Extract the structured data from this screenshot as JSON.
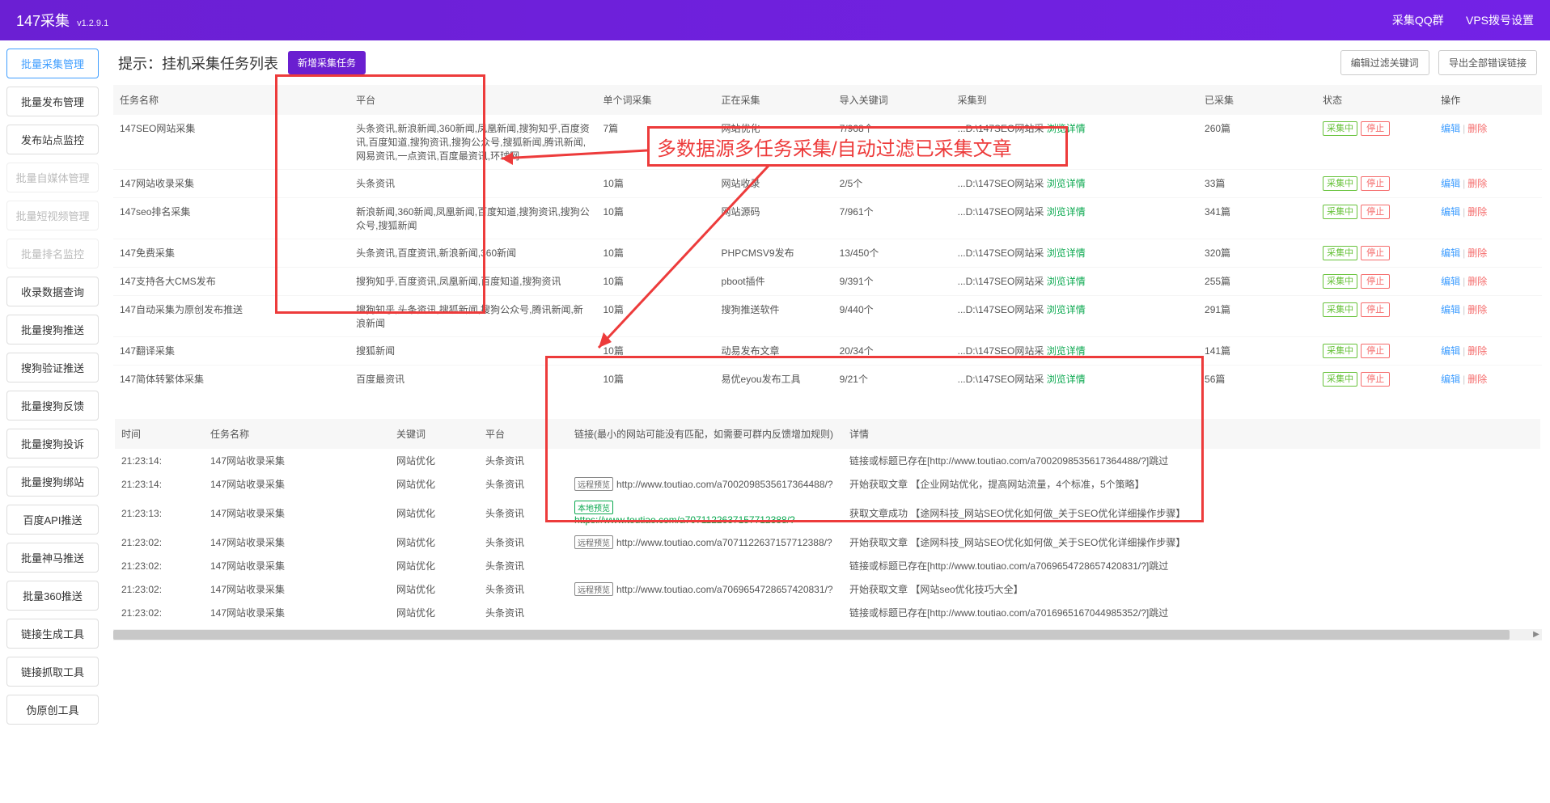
{
  "header": {
    "title": "147采集",
    "version": "v1.2.9.1",
    "right_links": [
      "采集QQ群",
      "VPS拨号设置"
    ]
  },
  "sidebar": {
    "items": [
      {
        "label": "批量采集管理",
        "state": "active"
      },
      {
        "label": "批量发布管理",
        "state": ""
      },
      {
        "label": "发布站点监控",
        "state": ""
      },
      {
        "label": "批量自媒体管理",
        "state": "disabled"
      },
      {
        "label": "批量短视频管理",
        "state": "disabled"
      },
      {
        "label": "批量排名监控",
        "state": "disabled"
      },
      {
        "label": "收录数据查询",
        "state": ""
      },
      {
        "label": "批量搜狗推送",
        "state": ""
      },
      {
        "label": "搜狗验证推送",
        "state": ""
      },
      {
        "label": "批量搜狗反馈",
        "state": ""
      },
      {
        "label": "批量搜狗投诉",
        "state": ""
      },
      {
        "label": "批量搜狗绑站",
        "state": ""
      },
      {
        "label": "百度API推送",
        "state": ""
      },
      {
        "label": "批量神马推送",
        "state": ""
      },
      {
        "label": "批量360推送",
        "state": ""
      },
      {
        "label": "链接生成工具",
        "state": ""
      },
      {
        "label": "链接抓取工具",
        "state": ""
      },
      {
        "label": "伪原创工具",
        "state": ""
      }
    ]
  },
  "page": {
    "heading": "提示：挂机采集任务列表",
    "new_btn": "新增采集任务",
    "btn_filter": "编辑过滤关键词",
    "btn_export": "导出全部错误链接"
  },
  "annotation": {
    "text": "多数据源多任务采集/自动过滤已采集文章"
  },
  "tasks": {
    "headers": {
      "name": "任务名称",
      "platform": "平台",
      "single": "单个词采集",
      "now": "正在采集",
      "import": "导入关键词",
      "to": "采集到",
      "done": "已采集",
      "status": "状态",
      "ops": "操作"
    },
    "view_detail": "浏览详情",
    "status_running": "采集中",
    "status_stop": "停止",
    "op_edit": "编辑",
    "op_delete": "删除",
    "rows": [
      {
        "name": "147SEO网站采集",
        "platform": "头条资讯,新浪新闻,360新闻,凤凰新闻,搜狗知乎,百度资讯,百度知道,搜狗资讯,搜狗公众号,搜狐新闻,腾讯新闻,网易资讯,一点资讯,百度最资讯,环球网",
        "single": "7篇",
        "now": "网站优化",
        "import": "7/968个",
        "to": "...D:\\147SEO网站采",
        "done": "260篇"
      },
      {
        "name": "147网站收录采集",
        "platform": "头条资讯",
        "single": "10篇",
        "now": "网站收录",
        "import": "2/5个",
        "to": "...D:\\147SEO网站采",
        "done": "33篇"
      },
      {
        "name": "147seo排名采集",
        "platform": "新浪新闻,360新闻,凤凰新闻,百度知道,搜狗资讯,搜狗公众号,搜狐新闻",
        "single": "10篇",
        "now": "网站源码",
        "import": "7/961个",
        "to": "...D:\\147SEO网站采",
        "done": "341篇"
      },
      {
        "name": "147免费采集",
        "platform": "头条资讯,百度资讯,新浪新闻,360新闻",
        "single": "10篇",
        "now": "PHPCMSV9发布",
        "import": "13/450个",
        "to": "...D:\\147SEO网站采",
        "done": "320篇"
      },
      {
        "name": "147支持各大CMS发布",
        "platform": "搜狗知乎,百度资讯,凤凰新闻,百度知道,搜狗资讯",
        "single": "10篇",
        "now": "pboot插件",
        "import": "9/391个",
        "to": "...D:\\147SEO网站采",
        "done": "255篇"
      },
      {
        "name": "147自动采集为原创发布推送",
        "platform": "搜狗知乎,头条资讯,搜狐新闻,搜狗公众号,腾讯新闻,新浪新闻",
        "single": "10篇",
        "now": "搜狗推送软件",
        "import": "9/440个",
        "to": "...D:\\147SEO网站采",
        "done": "291篇"
      },
      {
        "name": "147翻译采集",
        "platform": "搜狐新闻",
        "single": "10篇",
        "now": "动易发布文章",
        "import": "20/34个",
        "to": "...D:\\147SEO网站采",
        "done": "141篇"
      },
      {
        "name": "147简体转繁体采集",
        "platform": "百度最资讯",
        "single": "10篇",
        "now": "易优eyou发布工具",
        "import": "9/21个",
        "to": "...D:\\147SEO网站采",
        "done": "56篇"
      }
    ]
  },
  "logs": {
    "headers": {
      "time": "时间",
      "task": "任务名称",
      "keyword": "关键词",
      "platform": "平台",
      "link": "链接(最小的网站可能没有匹配，如需要可群内反馈增加规则)",
      "detail": "详情"
    },
    "tag_remote": "远程预览",
    "tag_local": "本地预览",
    "rows": [
      {
        "time": "21:23:14:",
        "task": "147网站收录采集",
        "kw": "网站优化",
        "plat": "头条资讯",
        "link_type": "",
        "link": "",
        "detail": "链接或标题已存在[http://www.toutiao.com/a7002098535617364488/?]跳过"
      },
      {
        "time": "21:23:14:",
        "task": "147网站收录采集",
        "kw": "网站优化",
        "plat": "头条资讯",
        "link_type": "remote",
        "link": "http://www.toutiao.com/a7002098535617364488/?",
        "detail": "开始获取文章 【企业网站优化，提高网站流量，4个标准，5个策略】"
      },
      {
        "time": "21:23:13:",
        "task": "147网站收录采集",
        "kw": "网站优化",
        "plat": "头条资讯",
        "link_type": "local",
        "link": "https://www.toutiao.com/a7071122637157712388/?",
        "detail": "获取文章成功 【途网科技_网站SEO优化如何做_关于SEO优化详细操作步骤】"
      },
      {
        "time": "21:23:02:",
        "task": "147网站收录采集",
        "kw": "网站优化",
        "plat": "头条资讯",
        "link_type": "remote",
        "link": "http://www.toutiao.com/a7071122637157712388/?",
        "detail": "开始获取文章 【途网科技_网站SEO优化如何做_关于SEO优化详细操作步骤】"
      },
      {
        "time": "21:23:02:",
        "task": "147网站收录采集",
        "kw": "网站优化",
        "plat": "头条资讯",
        "link_type": "",
        "link": "",
        "detail": "链接或标题已存在[http://www.toutiao.com/a7069654728657420831/?]跳过"
      },
      {
        "time": "21:23:02:",
        "task": "147网站收录采集",
        "kw": "网站优化",
        "plat": "头条资讯",
        "link_type": "remote",
        "link": "http://www.toutiao.com/a7069654728657420831/?",
        "detail": "开始获取文章 【网站seo优化技巧大全】"
      },
      {
        "time": "21:23:02:",
        "task": "147网站收录采集",
        "kw": "网站优化",
        "plat": "头条资讯",
        "link_type": "",
        "link": "",
        "detail": "链接或标题已存在[http://www.toutiao.com/a7016965167044985352/?]跳过"
      }
    ]
  }
}
